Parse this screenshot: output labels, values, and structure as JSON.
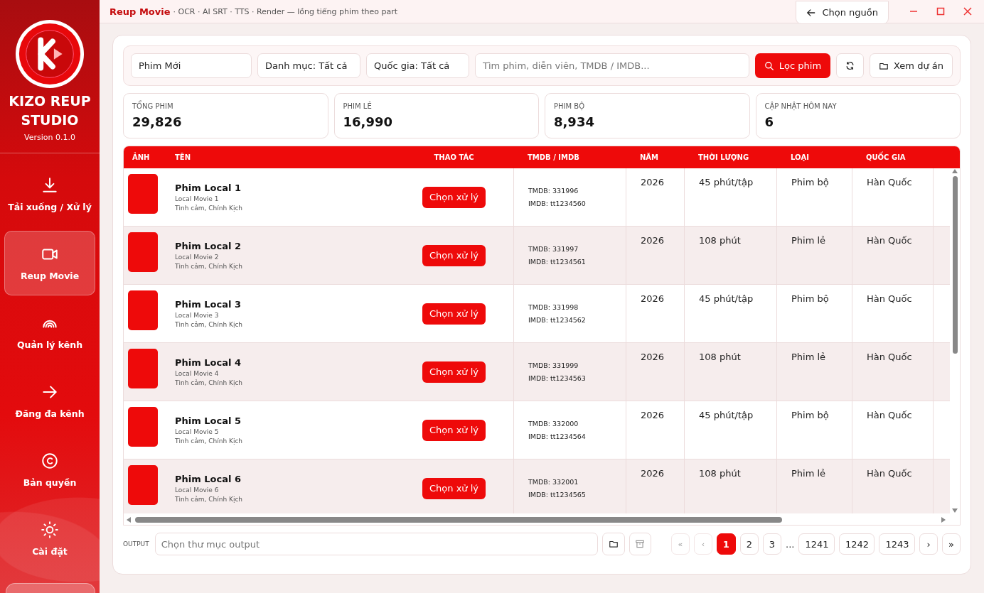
{
  "app": {
    "name_line1": "KIZO REUP",
    "name_line2": "STUDIO",
    "version": "Version 0.1.0"
  },
  "sidebar": {
    "items": [
      {
        "label": "Tải xuống / Xử lý",
        "selected": false
      },
      {
        "label": "Reup Movie",
        "selected": true
      },
      {
        "label": "Quản lý kênh",
        "selected": false
      },
      {
        "label": "Đăng đa kênh",
        "selected": false
      },
      {
        "label": "Bản quyền",
        "selected": false
      },
      {
        "label": "Cài đặt",
        "selected": false
      }
    ]
  },
  "window": {
    "title": "Reup Movie",
    "subtitle": "· OCR · AI SRT · TTS · Render — lồng tiếng phim theo part",
    "back_button": "Chọn nguồn"
  },
  "filters": {
    "list": "Phim Mới",
    "category": "Danh mục: Tất cả",
    "country": "Quốc gia: Tất cả",
    "search_placeholder": "Tìm phim, diễn viên, TMDB / IMDB...",
    "filter_button": "Lọc phim",
    "projects_button": "Xem dự án"
  },
  "stats": [
    {
      "label": "TỔNG PHIM",
      "value": "29,826"
    },
    {
      "label": "PHIM LẺ",
      "value": "16,990"
    },
    {
      "label": "PHIM BỘ",
      "value": "8,934"
    },
    {
      "label": "CẬP NHẬT HÔM NAY",
      "value": "6"
    }
  ],
  "table": {
    "columns": [
      "ẢNH",
      "TÊN",
      "THAO TÁC",
      "TMDB / IMDB",
      "NĂM",
      "THỜI LƯỢNG",
      "LOẠI",
      "QUỐC GIA"
    ],
    "rows": [
      {
        "title": "Phim Local 1",
        "original": "Local Movie 1",
        "genres": "Tình cảm, Chính Kịch",
        "action": "Chọn xử lý",
        "tmdb": "TMDB: 331996",
        "imdb": "IMDB: tt1234560",
        "year": "2026",
        "duration": "45 phút/tập",
        "type": "Phim bộ",
        "country": "Hàn Quốc"
      },
      {
        "title": "Phim Local 2",
        "original": "Local Movie 2",
        "genres": "Tình cảm, Chính Kịch",
        "action": "Chọn xử lý",
        "tmdb": "TMDB: 331997",
        "imdb": "IMDB: tt1234561",
        "year": "2026",
        "duration": "108 phút",
        "type": "Phim lẻ",
        "country": "Hàn Quốc"
      },
      {
        "title": "Phim Local 3",
        "original": "Local Movie 3",
        "genres": "Tình cảm, Chính Kịch",
        "action": "Chọn xử lý",
        "tmdb": "TMDB: 331998",
        "imdb": "IMDB: tt1234562",
        "year": "2026",
        "duration": "45 phút/tập",
        "type": "Phim bộ",
        "country": "Hàn Quốc"
      },
      {
        "title": "Phim Local 4",
        "original": "Local Movie 4",
        "genres": "Tình cảm, Chính Kịch",
        "action": "Chọn xử lý",
        "tmdb": "TMDB: 331999",
        "imdb": "IMDB: tt1234563",
        "year": "2026",
        "duration": "108 phút",
        "type": "Phim lẻ",
        "country": "Hàn Quốc"
      },
      {
        "title": "Phim Local 5",
        "original": "Local Movie 5",
        "genres": "Tình cảm, Chính Kịch",
        "action": "Chọn xử lý",
        "tmdb": "TMDB: 332000",
        "imdb": "IMDB: tt1234564",
        "year": "2026",
        "duration": "45 phút/tập",
        "type": "Phim bộ",
        "country": "Hàn Quốc"
      },
      {
        "title": "Phim Local 6",
        "original": "Local Movie 6",
        "genres": "Tình cảm, Chính Kịch",
        "action": "Chọn xử lý",
        "tmdb": "TMDB: 332001",
        "imdb": "IMDB: tt1234565",
        "year": "2026",
        "duration": "108 phút",
        "type": "Phim lẻ",
        "country": "Hàn Quốc"
      }
    ]
  },
  "output": {
    "label": "OUTPUT",
    "placeholder": "Chọn thư mục output"
  },
  "pagination": {
    "first": "«",
    "prev": "‹",
    "pages": [
      {
        "label": "1",
        "selected": true
      },
      {
        "label": "2",
        "selected": false
      },
      {
        "label": "3",
        "selected": false
      },
      {
        "label": "...",
        "kind": "gap"
      },
      {
        "label": "1241",
        "selected": false
      },
      {
        "label": "1242",
        "selected": false
      },
      {
        "label": "1243",
        "selected": false
      }
    ],
    "next": "›",
    "last": "»"
  }
}
